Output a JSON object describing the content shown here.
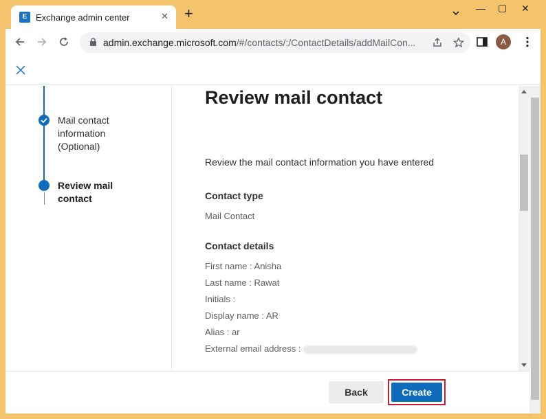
{
  "browser": {
    "tab_title": "Exchange admin center",
    "tab_logo": "E",
    "url_host": "admin.exchange.microsoft.com",
    "url_path": "/#/contacts/:/ContactDetails/addMailCon...",
    "profile_initial": "A"
  },
  "stepper": {
    "steps": [
      {
        "label_lines": [
          "Mail contact",
          "information",
          "(Optional)"
        ],
        "state": "completed"
      },
      {
        "label_lines": [
          "Review mail",
          "contact"
        ],
        "state": "current"
      }
    ]
  },
  "content": {
    "title": "Review mail contact",
    "intro": "Review the mail contact information you have entered",
    "contact_type_heading": "Contact type",
    "contact_type_value": "Mail Contact",
    "contact_details_heading": "Contact details",
    "details": [
      "First name : Anisha",
      "Last name : Rawat",
      "Initials :",
      "Display name : AR",
      "Alias : ar",
      "External email address :"
    ]
  },
  "footer": {
    "back_label": "Back",
    "create_label": "Create"
  },
  "colors": {
    "accent": "#0f6cbd",
    "highlight_border": "#c41e3a",
    "window_frame": "#f3c46b"
  }
}
